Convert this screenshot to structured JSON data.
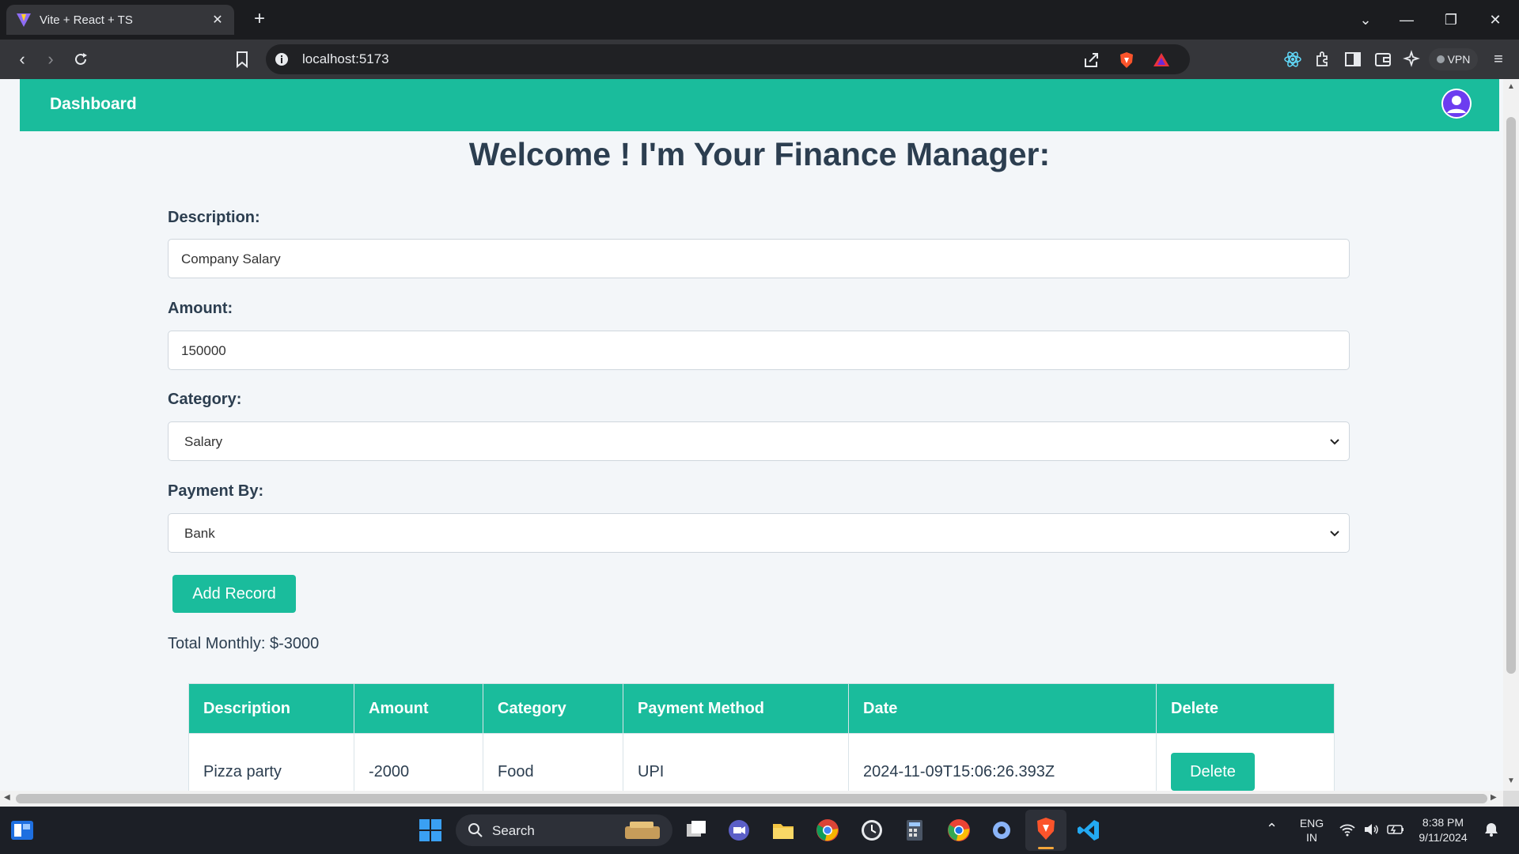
{
  "browser": {
    "tab_title": "Vite + React + TS",
    "url": "localhost:5173",
    "vpn_label": "VPN"
  },
  "app": {
    "nav_brand": "Dashboard",
    "heading": "Welcome ! I'm Your Finance Manager:",
    "form": {
      "description_label": "Description:",
      "description_value": "Company Salary",
      "amount_label": "Amount:",
      "amount_value": "150000",
      "category_label": "Category:",
      "category_value": "Salary",
      "payment_label": "Payment By:",
      "payment_value": "Bank",
      "submit_label": "Add Record"
    },
    "total_monthly": "Total Monthly: $-3000",
    "table": {
      "headers": [
        "Description",
        "Amount",
        "Category",
        "Payment Method",
        "Date",
        "Delete"
      ],
      "rows": [
        {
          "description": "Pizza party",
          "amount": "-2000",
          "category": "Food",
          "payment_method": "UPI",
          "date": "2024-11-09T15:06:26.393Z",
          "delete_label": "Delete"
        }
      ]
    },
    "accent_color": "#1abc9c"
  },
  "taskbar": {
    "search_label": "Search",
    "lang_top": "ENG",
    "lang_bottom": "IN",
    "time": "8:38 PM",
    "date": "9/11/2024"
  }
}
